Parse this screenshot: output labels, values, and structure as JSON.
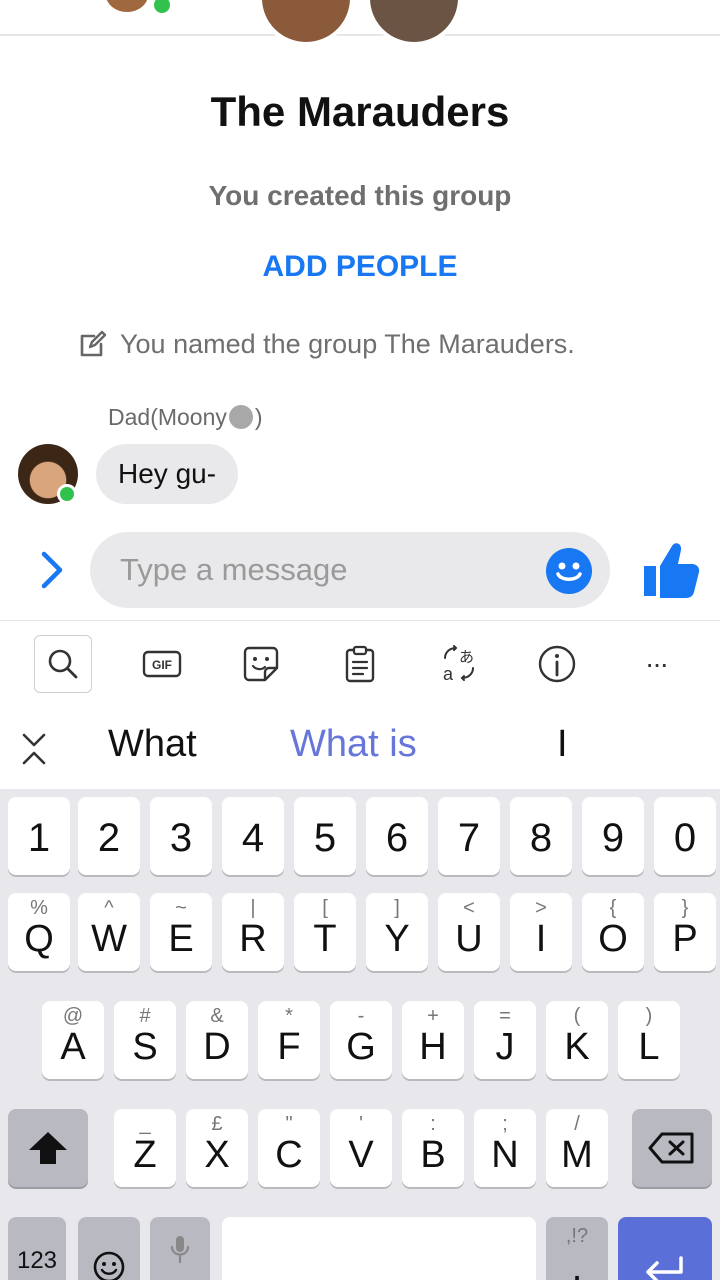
{
  "group": {
    "title": "The Marauders",
    "subtitle": "You created this group",
    "add_people_label": "ADD PEOPLE",
    "system_message": "You named the group The Marauders."
  },
  "chat": {
    "messages": [
      {
        "sender": "Dad(Moony",
        "sender_suffix": ")",
        "text": "Hey gu-"
      }
    ]
  },
  "composer": {
    "placeholder": "Type a message",
    "icons": [
      "chevron-right-icon",
      "emoji-icon",
      "thumbs-up-icon"
    ]
  },
  "keyboard": {
    "toolbar_icons": [
      "search-icon",
      "gif-icon",
      "sticker-icon",
      "clipboard-icon",
      "translate-icon",
      "info-icon",
      "more-icon"
    ],
    "gif_label": "GIF",
    "more_label": "···",
    "suggestions": [
      "What",
      "What is",
      "I"
    ],
    "number_row": [
      "1",
      "2",
      "3",
      "4",
      "5",
      "6",
      "7",
      "8",
      "9",
      "0"
    ],
    "row_q": {
      "main": [
        "Q",
        "W",
        "E",
        "R",
        "T",
        "Y",
        "U",
        "I",
        "O",
        "P"
      ],
      "sub": [
        "%",
        "^",
        "~",
        "|",
        "[",
        "]",
        "<",
        ">",
        "{",
        "}"
      ]
    },
    "row_a": {
      "main": [
        "A",
        "S",
        "D",
        "F",
        "G",
        "H",
        "J",
        "K",
        "L"
      ],
      "sub": [
        "@",
        "#",
        "&",
        "*",
        "-",
        "+",
        "=",
        "(",
        ")"
      ]
    },
    "row_z": {
      "main": [
        "Z",
        "X",
        "C",
        "V",
        "B",
        "N",
        "M"
      ],
      "sub": [
        "_",
        "£",
        "\"",
        "'",
        ":",
        ";",
        "/"
      ]
    },
    "symbols_label": "123",
    "punct_sub": ",!?",
    "punct_main": "."
  },
  "colors": {
    "accent": "#1877f2",
    "online": "#31c24d",
    "suggestion_highlight": "#6676d9",
    "enter_key": "#5b6fd8"
  }
}
